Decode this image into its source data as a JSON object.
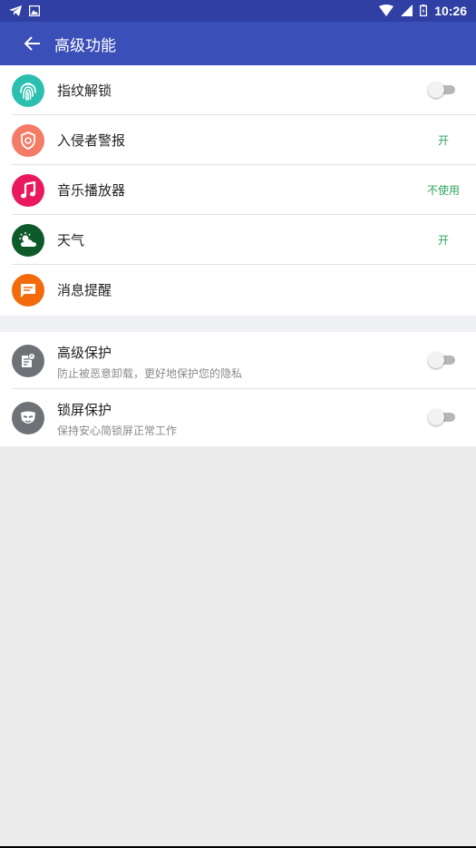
{
  "status_bar": {
    "time": "10:26",
    "icons": [
      "telegram-icon",
      "gallery-icon",
      "wifi-icon",
      "signal-icon",
      "battery-icon"
    ]
  },
  "app_bar": {
    "title": "高级功能",
    "color": "#3b4fb8"
  },
  "section1": {
    "items": [
      {
        "label": "指纹解锁",
        "icon": "fingerprint-icon",
        "icon_color": "#2bbfb0",
        "control": "toggle",
        "toggle_on": false
      },
      {
        "label": "入侵者警报",
        "icon": "shield-icon",
        "icon_color": "#f47b66",
        "status": "开"
      },
      {
        "label": "音乐播放器",
        "icon": "music-note-icon",
        "icon_color": "#e8195c",
        "status": "不使用"
      },
      {
        "label": "天气",
        "icon": "weather-icon",
        "icon_color": "#0e5a2a",
        "status": "开"
      },
      {
        "label": "消息提醒",
        "icon": "message-icon",
        "icon_color": "#f26a0a"
      }
    ]
  },
  "section2": {
    "items": [
      {
        "label": "高级保护",
        "sub": "防止被恶意卸载，更好地保护您的隐私",
        "icon": "protection-doc-icon",
        "icon_color": "#6e7277",
        "control": "toggle",
        "toggle_on": false
      },
      {
        "label": "锁屏保护",
        "sub": "保持安心简锁屏正常工作",
        "icon": "mask-icon",
        "icon_color": "#6e7277",
        "control": "toggle",
        "toggle_on": false
      }
    ]
  },
  "status_color": "#2fa35f"
}
